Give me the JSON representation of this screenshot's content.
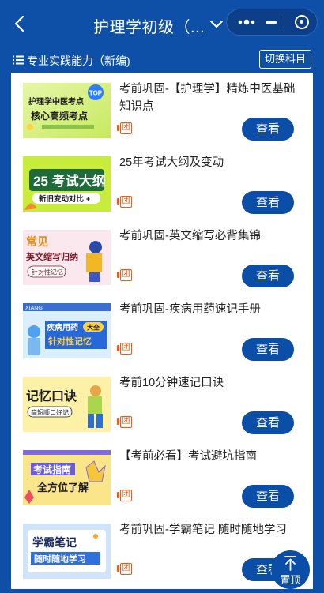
{
  "nav": {
    "title": "护理学初级（...",
    "subtitle": "专业实践能力（新编)",
    "switch_label": "切换科目"
  },
  "items": [
    {
      "title": "考前巩固-【护理学】精炼中医基础知识点",
      "button": "查看",
      "thumb": {
        "line1": "护理学中医考点",
        "line2": "核心高频考点",
        "badge": "TOP"
      }
    },
    {
      "title": "25年考试大纲及变动",
      "button": "查看",
      "thumb": {
        "line1": "25 考试大纲",
        "line2": "新旧变动对比 +"
      }
    },
    {
      "title": "考前巩固-英文缩写必背集锦",
      "button": "查看",
      "thumb": {
        "line1": "常见",
        "line2": "英文缩写归纳",
        "line3": "针对性记忆"
      }
    },
    {
      "title": "考前巩固-疾病用药速记手册",
      "button": "查看",
      "thumb": {
        "line1": "疾病用药",
        "tag": "大全",
        "line2": "针对性记忆",
        "top": "XIANG"
      }
    },
    {
      "title": "考前10分钟速记口诀",
      "button": "查看",
      "thumb": {
        "line1": "记忆口诀",
        "line2": "简短顺口好记"
      }
    },
    {
      "title": "【考前必看】考试避坑指南",
      "button": "查看",
      "thumb": {
        "line1": "考试指南",
        "line2": "全方位了解"
      }
    },
    {
      "title": "考前巩固-学霸笔记 随时随地学习",
      "button": "查看",
      "thumb": {
        "line1": "学霸笔记",
        "line2": "随时随地学习"
      }
    }
  ],
  "tuan_label": "团",
  "to_top_label": "置顶",
  "colors": {
    "primary": "#0e4fa8",
    "button": "#0b4ea7",
    "tuan": "#ec5a14"
  },
  "icons": [
    "back-arrow-icon",
    "chevron-down-icon",
    "more-dots-icon",
    "minimize-icon",
    "record-icon",
    "list-icon",
    "group-buy-icon",
    "arrow-up-icon"
  ]
}
